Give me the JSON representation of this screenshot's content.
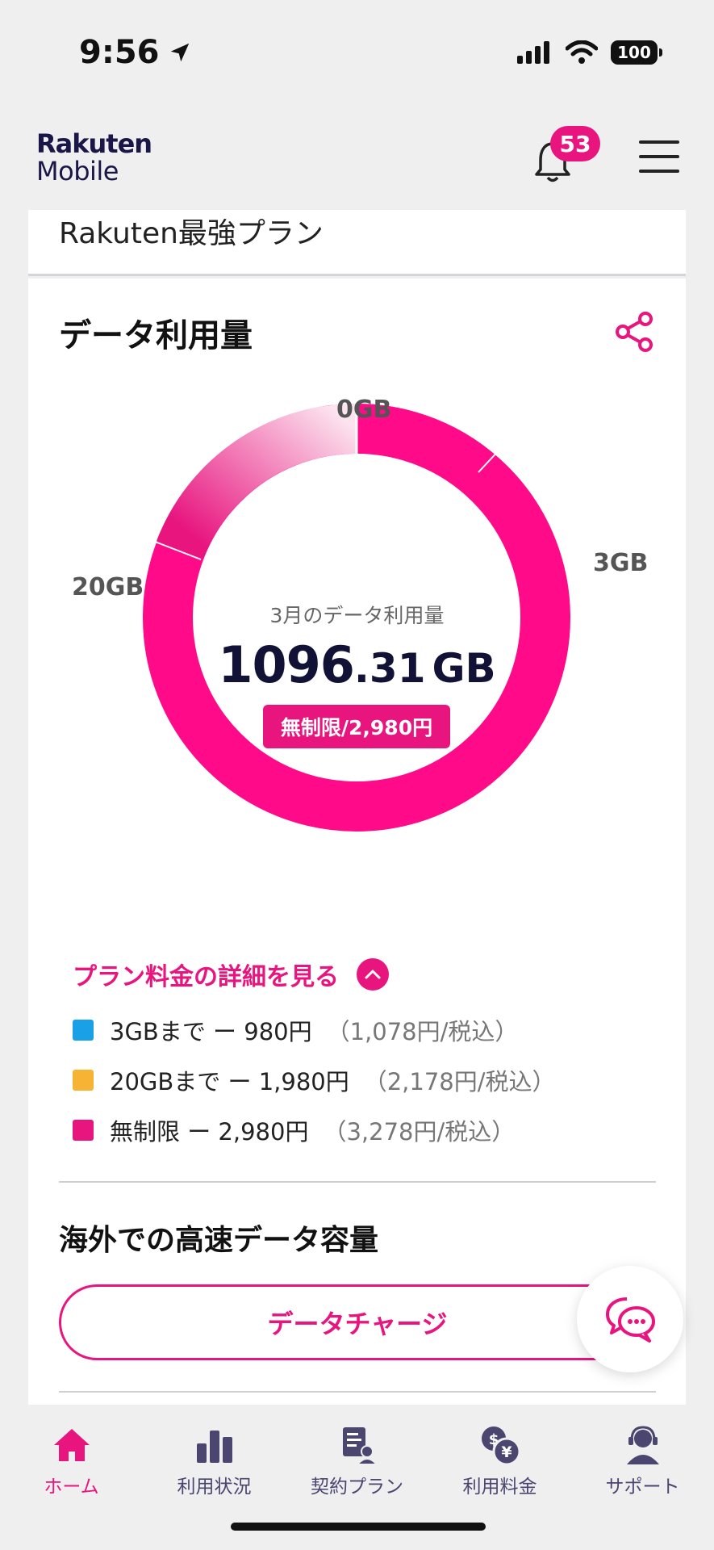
{
  "status_bar": {
    "time": "9:56",
    "battery": "100"
  },
  "header": {
    "logo_line1": "Rakuten",
    "logo_line2": "Mobile",
    "notification_count": "53"
  },
  "plan": {
    "name": "Rakuten最強プラン"
  },
  "data_usage": {
    "title": "データ利用量",
    "gauge_labels": {
      "zero": "0GB",
      "three": "3GB",
      "twenty": "20GB"
    },
    "caption": "3月のデータ利用量",
    "value_int": "1096",
    "value_dec": ".31",
    "unit": "GB",
    "tier_badge": "無制限/2,980円"
  },
  "plan_details": {
    "link_label": "プラン料金の詳細を見る",
    "tiers": [
      {
        "label": "3GBまで ー 980円",
        "tax": "（1,078円/税込）",
        "color": "#1aa0e6"
      },
      {
        "label": "20GBまで ー 1,980円",
        "tax": "（2,178円/税込）",
        "color": "#f7b434"
      },
      {
        "label": "無制限 ー 2,980円",
        "tax": "（3,278円/税込）",
        "color": "#e8157f"
      }
    ]
  },
  "overseas": {
    "title": "海外での高速データ容量",
    "charge_button": "データチャージ"
  },
  "bottom_nav": {
    "items": [
      {
        "label": "ホーム",
        "icon": "home-icon"
      },
      {
        "label": "利用状況",
        "icon": "bar-chart-icon"
      },
      {
        "label": "契約プラン",
        "icon": "contract-icon"
      },
      {
        "label": "利用料金",
        "icon": "currency-icon"
      },
      {
        "label": "サポート",
        "icon": "support-icon"
      }
    ]
  },
  "colors": {
    "accent": "#e8157f",
    "navy": "#1a1748"
  }
}
